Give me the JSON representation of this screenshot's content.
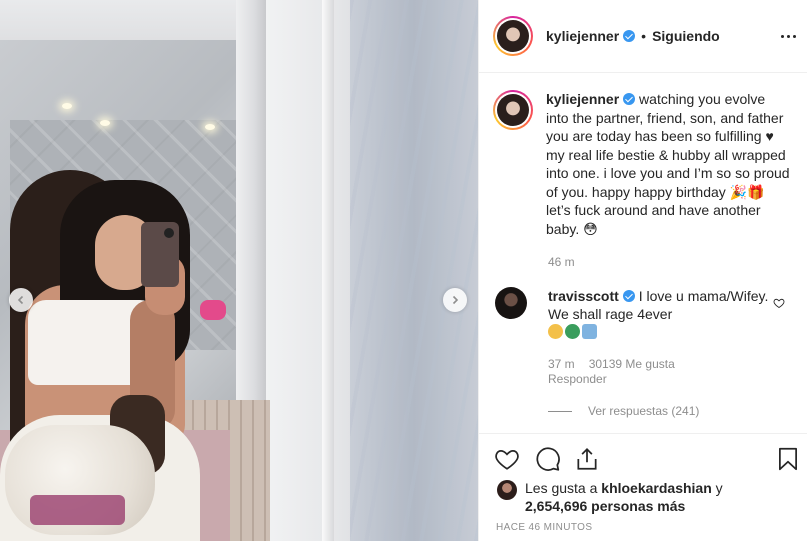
{
  "post": {
    "author": "kyliejenner",
    "follow_sep": "•",
    "follow_label": "Siguiendo",
    "caption": "watching you evolve into the partner, friend, son, and father you are today has been so fulfilling ♥ my real life bestie & hubby all wrapped into one. i love you and I’m so so proud of you. happy happy birthday 🎉🎁 let’s fuck around and have another baby. 😳",
    "time": "46 m",
    "posted_ago": "HACE 46 MINUTOS"
  },
  "comment": {
    "author": "travisscott",
    "text_line": "I love u mama/Wifey. We shall rage 4ever",
    "time": "37 m",
    "likes": "30139 Me gusta",
    "reply_label": "Responder",
    "view_replies": "Ver respuestas (241)"
  },
  "likes": {
    "prefix": "Les gusta a",
    "user": "khloekardashian",
    "conj": "y",
    "others": "2,654,696 personas más"
  },
  "icons": {
    "heart": "heart-icon",
    "comment": "comment-icon",
    "share": "share-icon",
    "bookmark": "bookmark-icon",
    "more": "more-options-icon",
    "prev": "chevron-left-icon",
    "next": "chevron-right-icon"
  },
  "colors": {
    "verified": "#3897f0",
    "muted_text": "#8e8e8e",
    "text": "#262626"
  }
}
